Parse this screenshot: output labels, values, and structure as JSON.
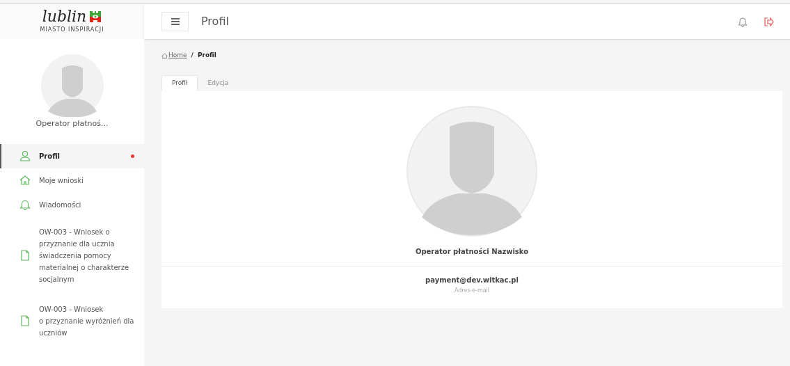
{
  "logo": {
    "wordmark": "lublin",
    "tagline": "MIASTO INSPIRACJI"
  },
  "header": {
    "title": "Profil"
  },
  "sidebar": {
    "user_name": "Operator płatnoś...",
    "items": [
      {
        "kind": "user",
        "label": "Profil",
        "selected": true,
        "badge_dot": true
      },
      {
        "kind": "home",
        "label": "Moje wnioski",
        "selected": false,
        "badge_dot": false
      },
      {
        "kind": "bell",
        "label": "Wiadomości",
        "selected": false,
        "badge_dot": false
      },
      {
        "kind": "file",
        "label": "OW-003 - Wniosek o przyznanie dla ucznia świadczenia pomocy materialnej o charakterze socjalnym",
        "selected": false,
        "badge_dot": false
      },
      {
        "kind": "file",
        "label": "OW-003 - Wniosek\no przyznanie wyróżnień dla uczniów",
        "selected": false,
        "badge_dot": false
      }
    ]
  },
  "breadcrumb": [
    {
      "label": "Home",
      "link": true
    },
    {
      "separator": "/",
      "label": "Profil",
      "link": false
    }
  ],
  "tabs": [
    {
      "label": "Profil",
      "selected": true
    },
    {
      "label": "Edycja",
      "selected": false
    }
  ],
  "profile": {
    "name": "Operator płatności Nazwisko",
    "email": "payment@dev.witkac.pl",
    "email_label": "Adres e-mail"
  }
}
